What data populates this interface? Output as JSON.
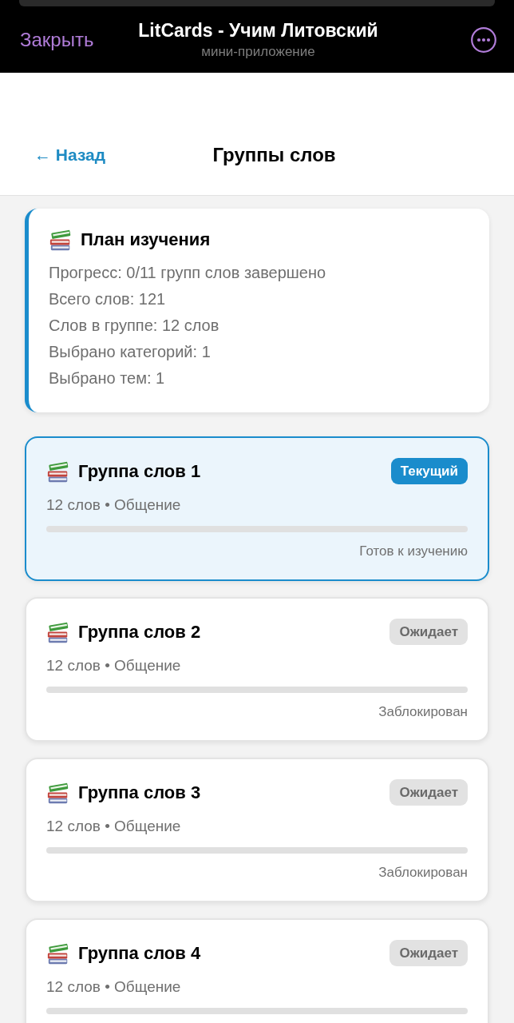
{
  "app_header": {
    "close_button": "Закрыть",
    "title": "LitCards - Учим Литовский",
    "subtitle": "мини-приложение"
  },
  "nav": {
    "back_button": "← Назад",
    "title": "Группы слов"
  },
  "plan_card": {
    "title": "План изучения",
    "lines": [
      "Прогресс: 0/11 групп слов завершено",
      "Всего слов: 121",
      "Слов в группе: 12 слов",
      "Выбрано категорий: 1",
      "Выбрано тем: 1"
    ]
  },
  "groups": [
    {
      "title": "Группа слов 1",
      "badge": "Текущий",
      "selected": true,
      "meta": "12 слов • Общение",
      "status": "Готов к изучению"
    },
    {
      "title": "Группа слов 2",
      "badge": "Ожидает",
      "selected": false,
      "meta": "12 слов • Общение",
      "status": "Заблокирован"
    },
    {
      "title": "Группа слов 3",
      "badge": "Ожидает",
      "selected": false,
      "meta": "12 слов • Общение",
      "status": "Заблокирован"
    },
    {
      "title": "Группа слов 4",
      "badge": "Ожидает",
      "selected": false,
      "meta": "12 слов • Общение"
    }
  ]
}
